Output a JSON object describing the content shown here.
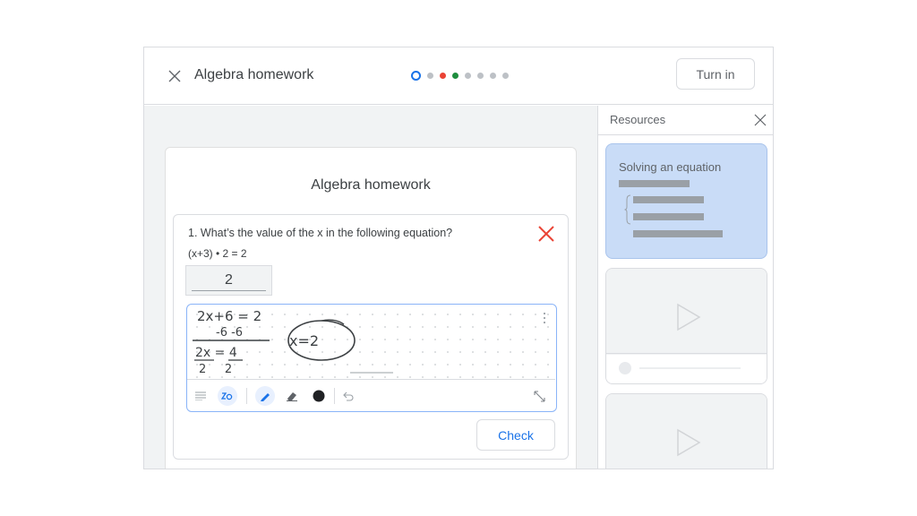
{
  "header": {
    "title": "Algebra homework",
    "turn_in_label": "Turn in",
    "progress": {
      "current_index": 0,
      "total": 8,
      "states": [
        "current",
        "unanswered",
        "incorrect",
        "correct",
        "unanswered",
        "unanswered",
        "unanswered",
        "unanswered"
      ]
    },
    "close_icon": "close-icon"
  },
  "assignment": {
    "title": "Algebra homework",
    "question": {
      "text": "1. What’s the value of the x in the following equation?",
      "equation": "(x+3) • 2 = 2",
      "answer_value": "2",
      "status": "incorrect",
      "status_icon": "wrong-x-icon",
      "scratchpad": {
        "lines": [
          "2x+6 = 2",
          "-6  -6",
          "2x = 4",
          "2     2"
        ],
        "circled_result": "x=2",
        "tools": [
          "text-icon",
          "handwriting-to-text-icon",
          "pen-icon",
          "eraser-icon",
          "color-icon",
          "undo-icon",
          "expand-icon"
        ],
        "active_tools": [
          "handwriting-to-text-icon",
          "pen-icon"
        ],
        "pen_color": "#202124"
      }
    },
    "check_label": "Check"
  },
  "resources": {
    "title": "Resources",
    "items": [
      {
        "type": "document",
        "title": "Solving an equation"
      },
      {
        "type": "video"
      },
      {
        "type": "video"
      }
    ]
  },
  "colors": {
    "accent": "#1a73e8",
    "incorrect": "#ea4335",
    "correct": "#1e8e3e",
    "resource_highlight": "#c9dcf7"
  }
}
